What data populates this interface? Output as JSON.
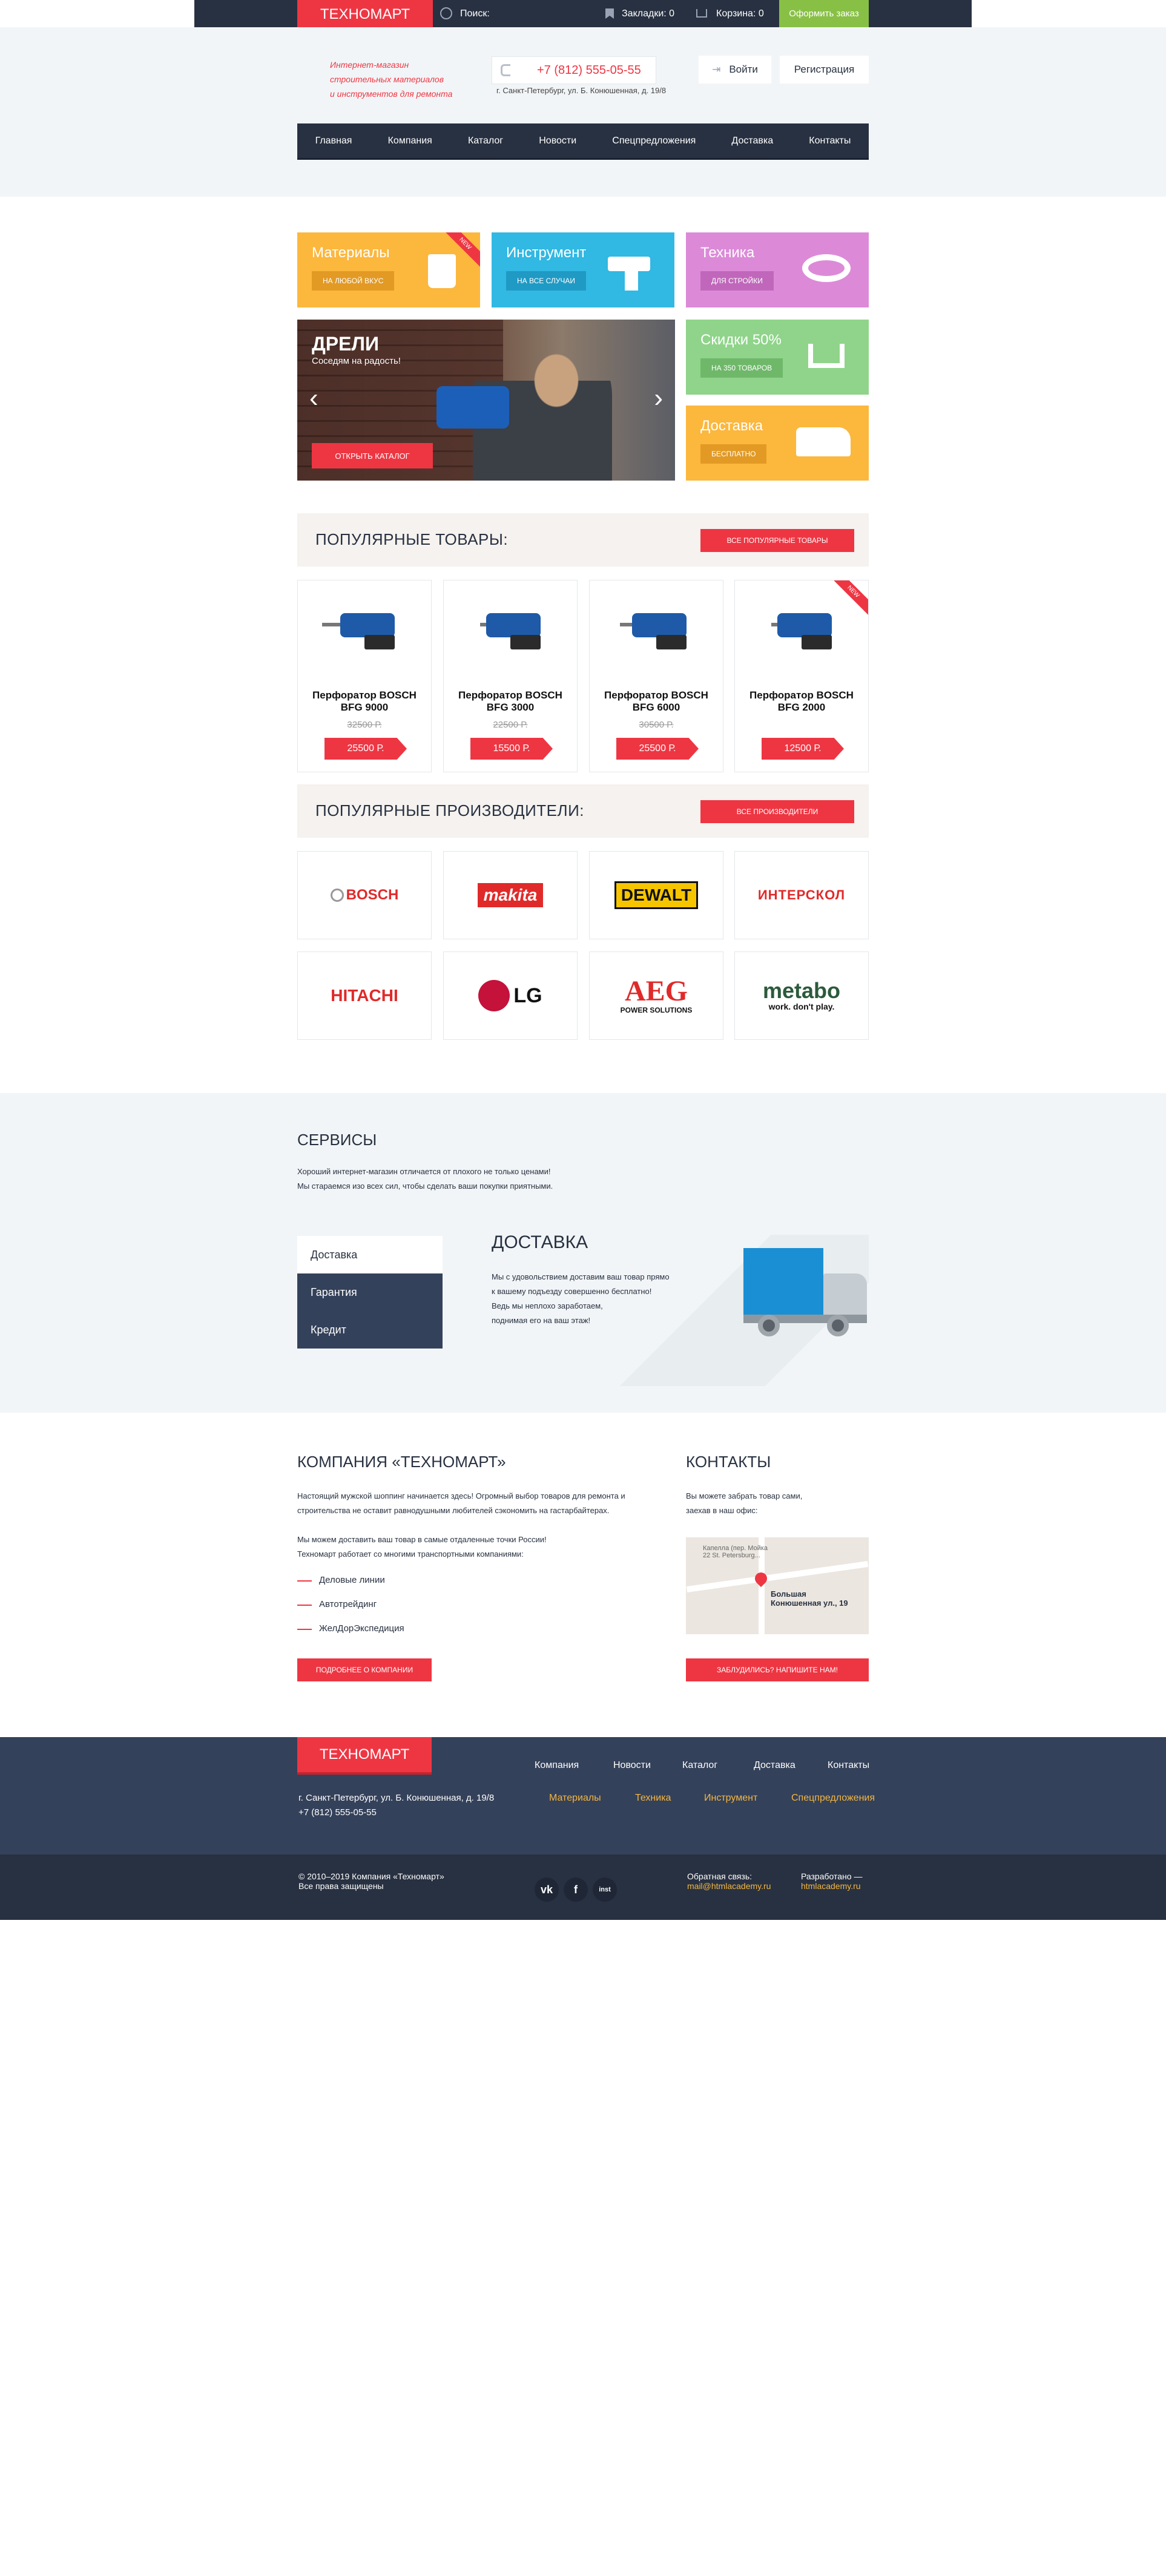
{
  "topbar": {
    "logo": "ТЕХНОМАРТ",
    "search_label": "Поиск:",
    "bookmarks": "Закладки: 0",
    "cart": "Корзина: 0",
    "order_btn": "Оформить заказ"
  },
  "header": {
    "slogan_line1": "Интернет-магазин",
    "slogan_line2": "строительных материалов",
    "slogan_line3": "и инструментов для ремонта",
    "phone": "+7 (812) 555-05-55",
    "address": "г. Санкт-Петербург, ул. Б. Конюшенная, д. 19/8",
    "login": "Войти",
    "register": "Регистрация"
  },
  "nav": [
    "Главная",
    "Компания",
    "Каталог",
    "Новости",
    "Спецпредложения",
    "Доставка",
    "Контакты"
  ],
  "tiles": {
    "materials": {
      "title": "Материалы",
      "btn": "НА ЛЮБОЙ ВКУС",
      "corner": "NEW"
    },
    "tools": {
      "title": "Инструмент",
      "btn": "НА ВСЕ СЛУЧАИ"
    },
    "tech": {
      "title": "Техника",
      "btn": "ДЛЯ СТРОЙКИ"
    },
    "discount": {
      "title": "Скидки 50%",
      "btn": "НА 350 ТОВАРОВ"
    },
    "delivery": {
      "title": "Доставка",
      "btn": "БЕСПЛАТНО"
    }
  },
  "slider": {
    "title": "ДРЕЛИ",
    "subtitle": "Соседям на радость!",
    "btn": "ОТКРЫТЬ КАТАЛОГ",
    "prev": "‹",
    "next": "›"
  },
  "popular": {
    "title": "ПОПУЛЯРНЫЕ ТОВАРЫ:",
    "btn": "ВСЕ ПОПУЛЯРНЫЕ ТОВАРЫ",
    "items": [
      {
        "name": "Перфоратор BOSCH BFG 9000",
        "old": "32500 Р.",
        "price": "25500 Р."
      },
      {
        "name": "Перфоратор BOSCH BFG 3000",
        "old": "22500 Р.",
        "price": "15500 Р."
      },
      {
        "name": "Перфоратор BOSCH BFG 6000",
        "old": "30500 Р.",
        "price": "25500 Р."
      },
      {
        "name": "Перфоратор BOSCH BFG 2000",
        "old": "",
        "price": "12500 Р.",
        "corner": "NEW"
      }
    ]
  },
  "brands": {
    "title": "ПОПУЛЯРНЫЕ ПРОИЗВОДИТЕЛИ:",
    "btn": "ВСЕ ПРОИЗВОДИТЕЛИ",
    "items": [
      "BOSCH",
      "makita",
      "DEWALT",
      "ИНТЕРСКОЛ",
      "HITACHI",
      "LG",
      "AEG",
      "metabo"
    ],
    "aeg_sub": "POWER SOLUTIONS",
    "metabo_sub": "work. don't play."
  },
  "services": {
    "title": "СЕРВИСЫ",
    "text1": "Хороший интернет-магазин отличается от плохого не только ценами!",
    "text2": "Мы стараемся изо всех сил, чтобы сделать ваши покупки приятными.",
    "tabs": [
      "Доставка",
      "Гарантия",
      "Кредит"
    ],
    "active_title": "ДОСТАВКА",
    "active_text1": "Мы с удовольствием доставим ваш товар прямо",
    "active_text2": "к вашему подъезду совершенно бесплатно!",
    "active_text3": "Ведь мы неплохо заработаем,",
    "active_text4": "поднимая его на ваш этаж!"
  },
  "company": {
    "title": "КОМПАНИЯ «ТЕХНОМАРТ»",
    "p1a": "Настоящий мужской шоппинг начинается здесь! Огромный выбор товаров для ремонта и",
    "p1b": "строительства не оставит равнодушными любителей сэкономить на гастарбайтерах.",
    "p2a": "Мы можем доставить ваш товар в самые отдаленные точки России!",
    "p2b": "Техномарт работает со многими транспортными компаниями:",
    "list": [
      "Деловые линии",
      "Автотрейдинг",
      "ЖелДорЭкспедиция"
    ],
    "btn": "ПОДРОБНЕЕ О КОМПАНИИ"
  },
  "contacts": {
    "title": "КОНТАКТЫ",
    "text1": "Вы можете забрать товар сами,",
    "text2": "заехав в наш офис:",
    "map_label1": "Большая",
    "map_label2": "Конюшенная ул., 19",
    "map_top1": "Капелла (пер. Мойка",
    "map_top2": "22 St. Petersburg...",
    "btn": "ЗАБЛУДИЛИСЬ? НАПИШИТЕ НАМ!"
  },
  "footer": {
    "logo": "ТЕХНОМАРТ",
    "address": "г. Санкт-Петербург, ул. Б. Конюшенная, д. 19/8",
    "phone": "+7 (812) 555-05-55",
    "nav1": [
      "Компания",
      "Новости",
      "Каталог",
      "Доставка",
      "Контакты"
    ],
    "nav2": [
      "Материалы",
      "Техника",
      "Инструмент",
      "Спецпредложения"
    ],
    "copyright1": "© 2010–2019 Компания «Техномарт»",
    "copyright2": "Все права защищены",
    "feedback_label": "Обратная связь:",
    "feedback_mail": "mail@htmlacademy.ru",
    "dev_label": "Разработано —",
    "dev_link": "htmlacademy.ru",
    "social": [
      "vk",
      "f",
      "inst"
    ]
  },
  "colors": {
    "accent": "#ee3643",
    "dark": "#283141",
    "green": "#88c046",
    "yellow": "#fcb73d",
    "blue": "#31b8e3",
    "pink": "#dc8ad8",
    "mint": "#8fd48a"
  }
}
